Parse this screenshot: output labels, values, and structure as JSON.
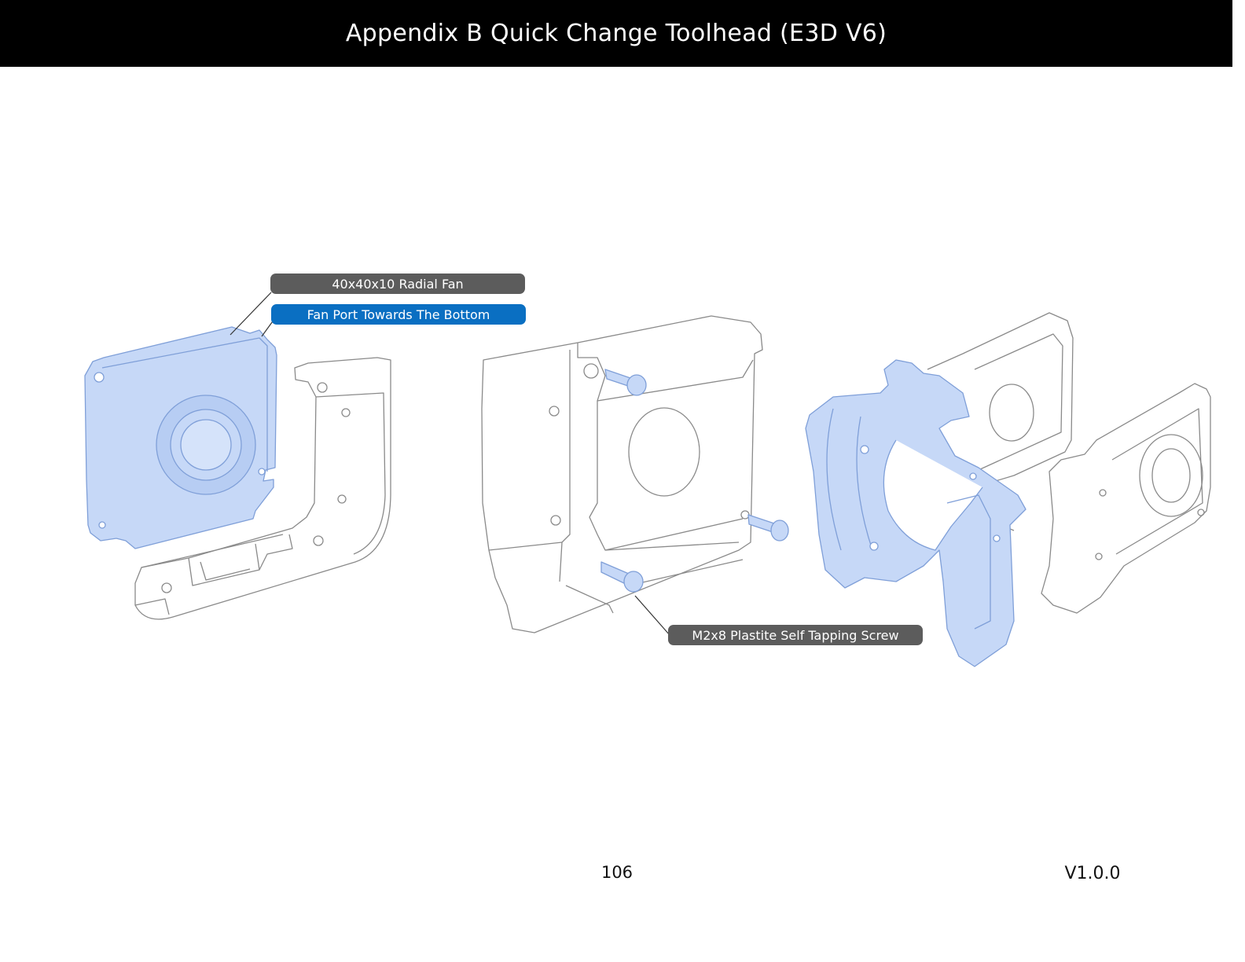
{
  "header": {
    "title": "Appendix B Quick Change Toolhead (E3D V6)"
  },
  "callouts": {
    "radial_fan": "40x40x10 Radial Fan",
    "fan_port": "Fan Port Towards The Bottom",
    "screw": "M2x8 Plastite Self Tapping Screw"
  },
  "footer": {
    "page_number": "106",
    "version": "V1.0.0"
  },
  "colors": {
    "header_bg": "#000000",
    "highlight_fill": "#c6d8f7",
    "highlight_stroke": "#7f9fd8",
    "callout_gray": "#5c5c5c",
    "callout_blue": "#0a6fc2",
    "line_art": "#8a8a8a"
  }
}
